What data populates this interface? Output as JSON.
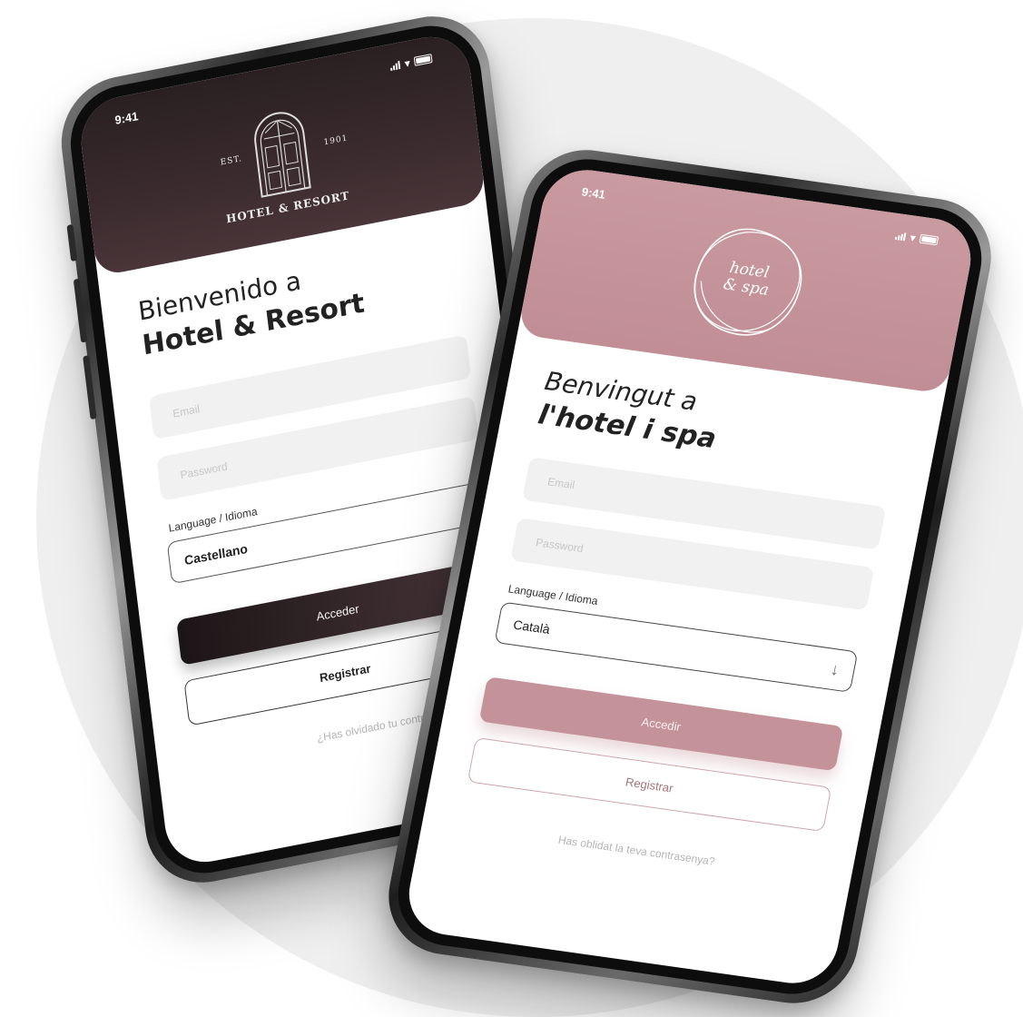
{
  "phone_left": {
    "status_time": "9:41",
    "logo": {
      "est_left": "EST.",
      "est_right": "1901",
      "name": "HOTEL & RESORT"
    },
    "welcome_line1": "Bienvenido a",
    "welcome_line2": "Hotel & Resort",
    "email_placeholder": "Email",
    "password_placeholder": "Password",
    "language_label": "Language / Idioma",
    "language_value": "Castellano",
    "primary_button": "Acceder",
    "secondary_button": "Registrar",
    "forgot_link": "¿Has olvidado tu contraseña?",
    "colors": {
      "header": "#2f2427",
      "accent": "#1c1517"
    }
  },
  "phone_right": {
    "status_time": "9:41",
    "logo": {
      "text_line1": "hotel",
      "text_line2": "& spa"
    },
    "welcome_line1": "Benvingut a",
    "welcome_line2": "l'hotel i spa",
    "email_placeholder": "Email",
    "password_placeholder": "Password",
    "language_label": "Language / Idioma",
    "language_value": "Català",
    "primary_button": "Accedir",
    "secondary_button": "Registrar",
    "forgot_link": "Has oblidat la teva contrasenya?",
    "colors": {
      "header": "#c4959b",
      "accent": "#c49399"
    }
  },
  "icons": [
    "signal-icon",
    "wifi-icon",
    "battery-icon",
    "arrow-down-icon",
    "door-logo-icon",
    "ribbon-logo-icon"
  ]
}
